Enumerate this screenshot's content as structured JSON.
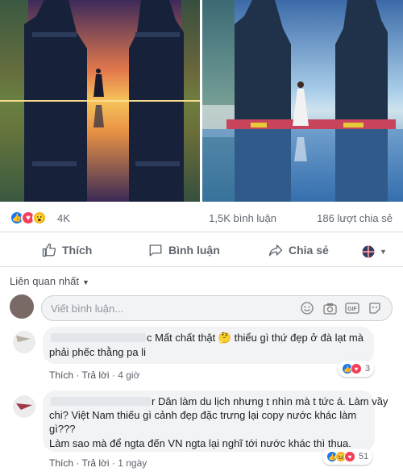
{
  "reactions": {
    "count": "4K",
    "comments": "1,5K bình luận",
    "shares": "186 lượt chia sẻ"
  },
  "actions": {
    "like": "Thích",
    "comment": "Bình luận",
    "share": "Chia sẻ"
  },
  "sort": {
    "label": "Liên quan nhất"
  },
  "composer": {
    "placeholder": "Viết bình luận..."
  },
  "comments": [
    {
      "line1": "c Mất chất thật 🤔 thiểu gì thứ đẹp ở đà lạt mà",
      "line2": "phải phếc thằng pa li",
      "like": "Thích",
      "reply": "Trả lời",
      "time": "4 giờ",
      "reaction_count": "3"
    },
    {
      "line1": "r Dân làm du lịch nhưng t nhìn mà t tức á. Làm vầy",
      "line2": "chi? Việt Nam thiếu gì cảnh đẹp đặc trưng lại copy nước khác làm",
      "line3": "gì???",
      "line4": "Làm sao mà để ngta đến VN ngta lại nghĩ tới nước khác thì thua.",
      "like": "Thích",
      "reply": "Trả lời",
      "time": "1 ngày",
      "reaction_count": "51"
    }
  ],
  "colors": {
    "like_blue": "#1877f2",
    "love_red": "#f33e58",
    "wow_yellow": "#f7b125",
    "meta_gray": "#606770"
  },
  "icons": [
    "like-icon",
    "love-icon",
    "wow-icon",
    "thumbs-up-icon",
    "comment-icon",
    "share-icon",
    "globe-icon",
    "emoji-icon",
    "camera-icon",
    "gif-icon",
    "sticker-icon"
  ]
}
